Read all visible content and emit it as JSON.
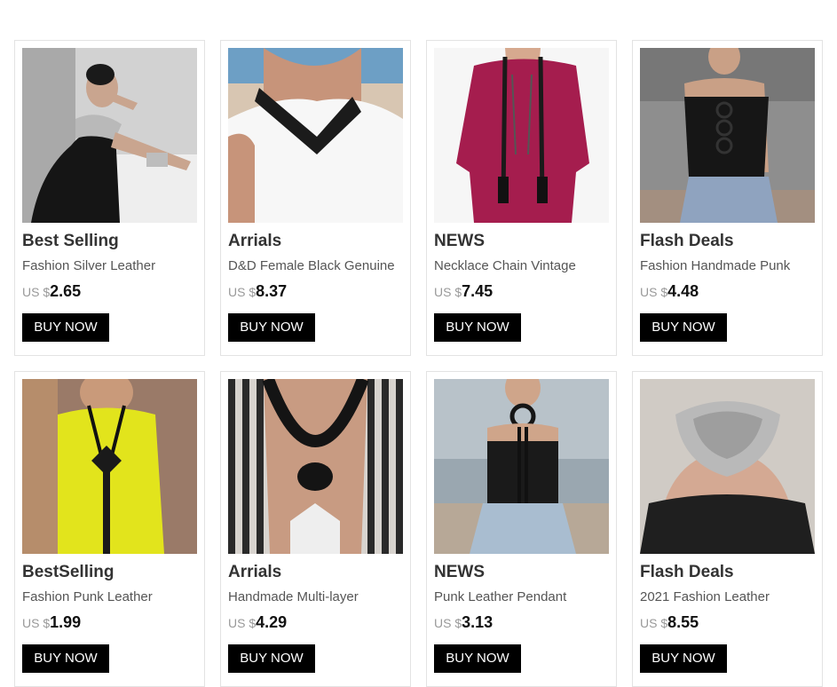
{
  "products": [
    {
      "title": "Best Selling",
      "subtitle": "Fashion Silver Leather",
      "currency": "US $",
      "price": "2.65",
      "button": "BUY NOW",
      "image": "woman-silver-cuff-photo",
      "bg": "#cfcfcf"
    },
    {
      "title": "Arrials",
      "subtitle": "D&D Female Black Genuine",
      "currency": "US $",
      "price": "8.37",
      "button": "BUY NOW",
      "image": "black-leather-collar-photo",
      "bg": "#6fa2c8"
    },
    {
      "title": "NEWS",
      "subtitle": "Necklace Chain Vintage",
      "currency": "US $",
      "price": "7.45",
      "button": "BUY NOW",
      "image": "magenta-dress-chain-necklace-photo",
      "bg": "#f4f4f4"
    },
    {
      "title": "Flash Deals",
      "subtitle": "Fashion Handmade Punk",
      "currency": "US $",
      "price": "4.48",
      "button": "BUY NOW",
      "image": "black-top-ring-pendant-photo",
      "bg": "#8a8a8a"
    },
    {
      "title": "BestSelling",
      "subtitle": "Fashion Punk Leather",
      "currency": "US $",
      "price": "1.99",
      "button": "BUY NOW",
      "image": "yellow-top-long-leather-necklace-photo",
      "bg": "#9b7b6a"
    },
    {
      "title": "Arrials",
      "subtitle": "Handmade Multi-layer",
      "currency": "US $",
      "price": "4.29",
      "button": "BUY NOW",
      "image": "striped-top-knot-necklace-photo",
      "bg": "#d8d4cf"
    },
    {
      "title": "NEWS",
      "subtitle": "Punk Leather Pendant",
      "currency": "US $",
      "price": "3.13",
      "button": "BUY NOW",
      "image": "black-top-ring-choker-photo",
      "bg": "#9aa7b0"
    },
    {
      "title": "Flash Deals",
      "subtitle": "2021 Fashion Leather",
      "currency": "US $",
      "price": "8.55",
      "button": "BUY NOW",
      "image": "silver-bib-collar-photo",
      "bg": "#cfcac4"
    }
  ]
}
